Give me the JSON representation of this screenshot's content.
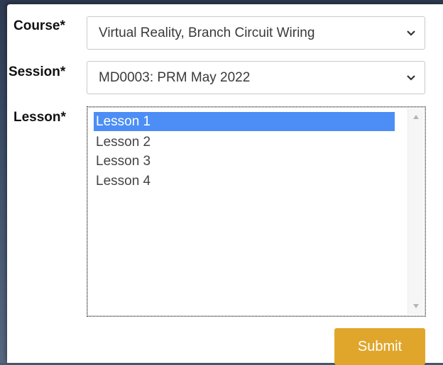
{
  "form": {
    "course": {
      "label": "Course*",
      "selected": "Virtual Reality, Branch Circuit Wiring"
    },
    "session": {
      "label": "Session*",
      "selected": "MD0003: PRM May 2022"
    },
    "lesson": {
      "label": "Lesson*",
      "items": [
        "Lesson 1",
        "Lesson 2",
        "Lesson 3",
        "Lesson 4"
      ],
      "selected_index": 0
    },
    "submit_label": "Submit"
  },
  "colors": {
    "accent_button": "#e0a62b",
    "selection": "#4c8ef5"
  },
  "icons": {
    "select_arrow": "chevron-down-icon",
    "scroll_up": "scroll-up-arrow-icon",
    "scroll_down": "scroll-down-arrow-icon"
  }
}
